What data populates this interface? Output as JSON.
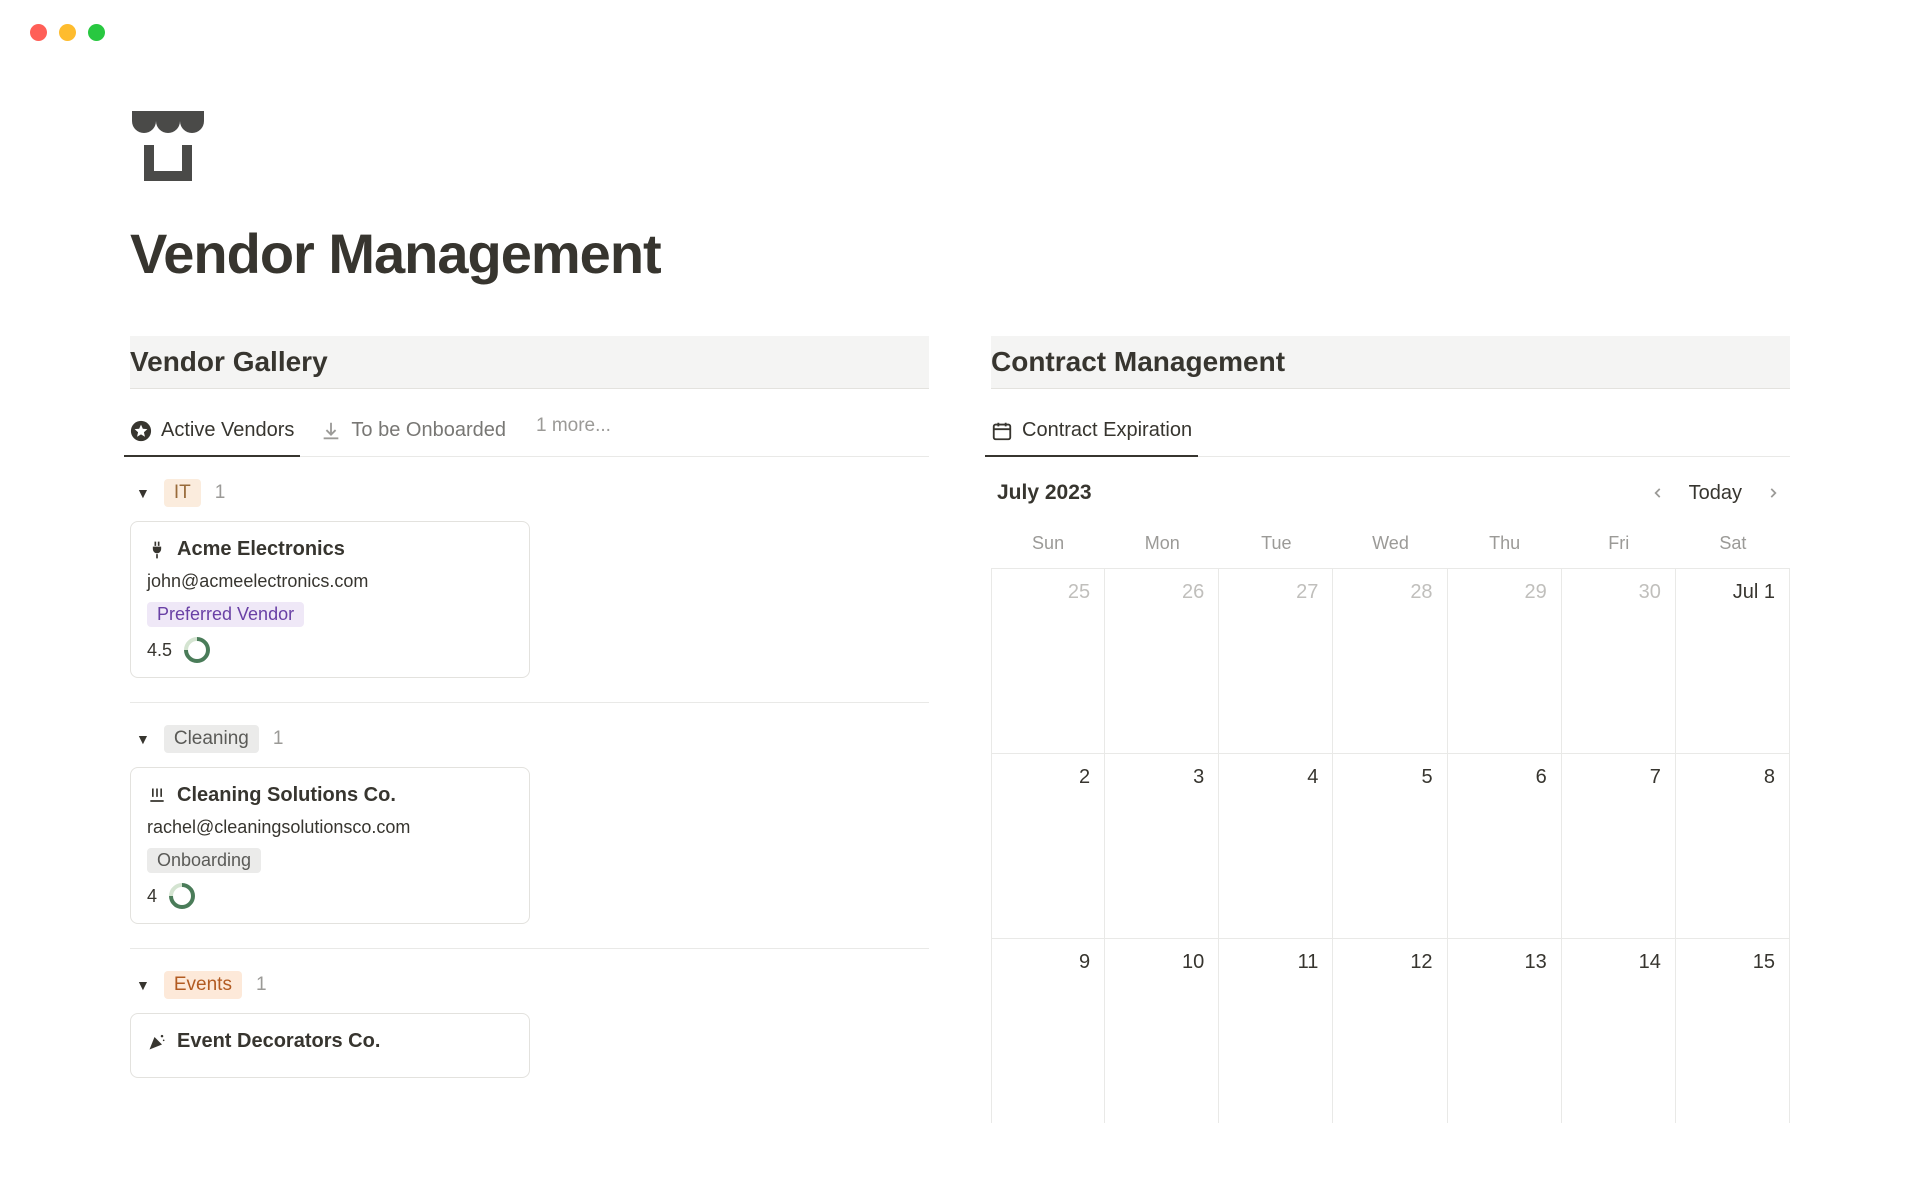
{
  "page": {
    "title": "Vendor Management"
  },
  "left": {
    "header": "Vendor Gallery",
    "tabs": {
      "active": "Active Vendors",
      "onboard": "To be Onboarded",
      "more": "1 more..."
    },
    "groups": {
      "it": {
        "name": "IT",
        "count": "1"
      },
      "cleaning": {
        "name": "Cleaning",
        "count": "1"
      },
      "events": {
        "name": "Events",
        "count": "1"
      }
    },
    "cards": {
      "acme": {
        "name": "Acme Electronics",
        "email": "john@acmeelectronics.com",
        "badge": "Preferred Vendor",
        "rating": "4.5"
      },
      "clean": {
        "name": "Cleaning Solutions Co.",
        "email": "rachel@cleaningsolutionsco.com",
        "badge": "Onboarding",
        "rating": "4"
      },
      "event": {
        "name": "Event Decorators Co."
      }
    }
  },
  "right": {
    "header": "Contract Management",
    "tab": "Contract Expiration",
    "month": "July 2023",
    "today": "Today",
    "dow": {
      "sun": "Sun",
      "mon": "Mon",
      "tue": "Tue",
      "wed": "Wed",
      "thu": "Thu",
      "fri": "Fri",
      "sat": "Sat"
    },
    "r1": {
      "c1": "25",
      "c2": "26",
      "c3": "27",
      "c4": "28",
      "c5": "29",
      "c6": "30",
      "c7": "Jul 1"
    },
    "r2": {
      "c1": "2",
      "c2": "3",
      "c3": "4",
      "c4": "5",
      "c5": "6",
      "c6": "7",
      "c7": "8"
    },
    "r3": {
      "c1": "9",
      "c2": "10",
      "c3": "11",
      "c4": "12",
      "c5": "13",
      "c6": "14",
      "c7": "15"
    }
  }
}
